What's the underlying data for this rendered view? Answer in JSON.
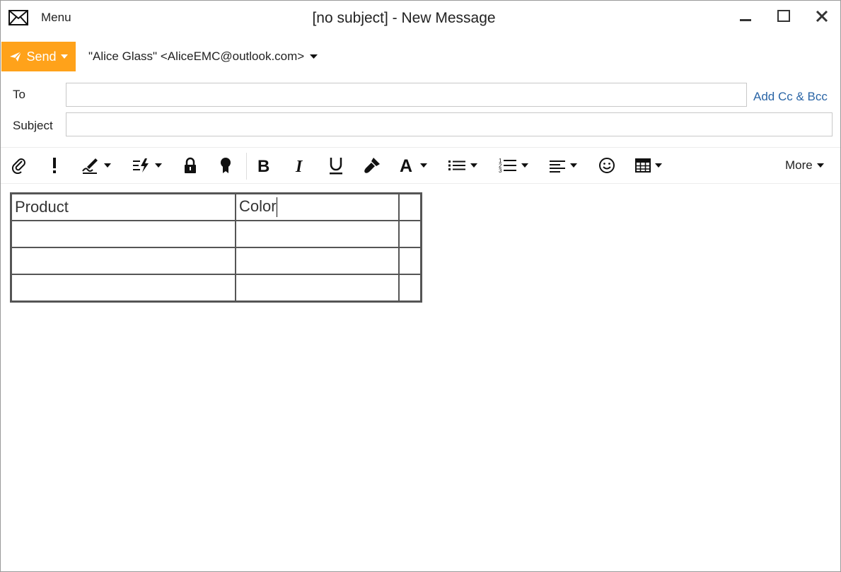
{
  "window": {
    "title": "[no subject] - New Message",
    "menu_label": "Menu",
    "app_icon": "envelope-icon",
    "controls": [
      "minimize-icon",
      "maximize-icon",
      "close-icon"
    ]
  },
  "compose": {
    "send_label": "Send",
    "from": "\"Alice Glass\" <AliceEMC@outlook.com>",
    "to_label": "To",
    "to_value": "",
    "subject_label": "Subject",
    "subject_value": "",
    "add_cc_bcc": "Add Cc & Bcc"
  },
  "toolbar": {
    "items": [
      "attach-icon",
      "importance-icon",
      "signature-icon",
      "quick-parts-icon",
      "encrypt-icon",
      "certificate-icon",
      "bold-icon",
      "italic-icon",
      "underline-icon",
      "format-painter-icon",
      "font-color-icon",
      "bullet-list-icon",
      "numbered-list-icon",
      "align-icon",
      "emoji-icon",
      "table-icon"
    ],
    "more_label": "More"
  },
  "body_table": {
    "rows": [
      [
        "Product",
        "Color",
        ""
      ],
      [
        "",
        "",
        ""
      ],
      [
        "",
        "",
        ""
      ],
      [
        "",
        "",
        ""
      ]
    ]
  },
  "colors": {
    "send_button": "#ffa21a",
    "link": "#2a65a6"
  }
}
